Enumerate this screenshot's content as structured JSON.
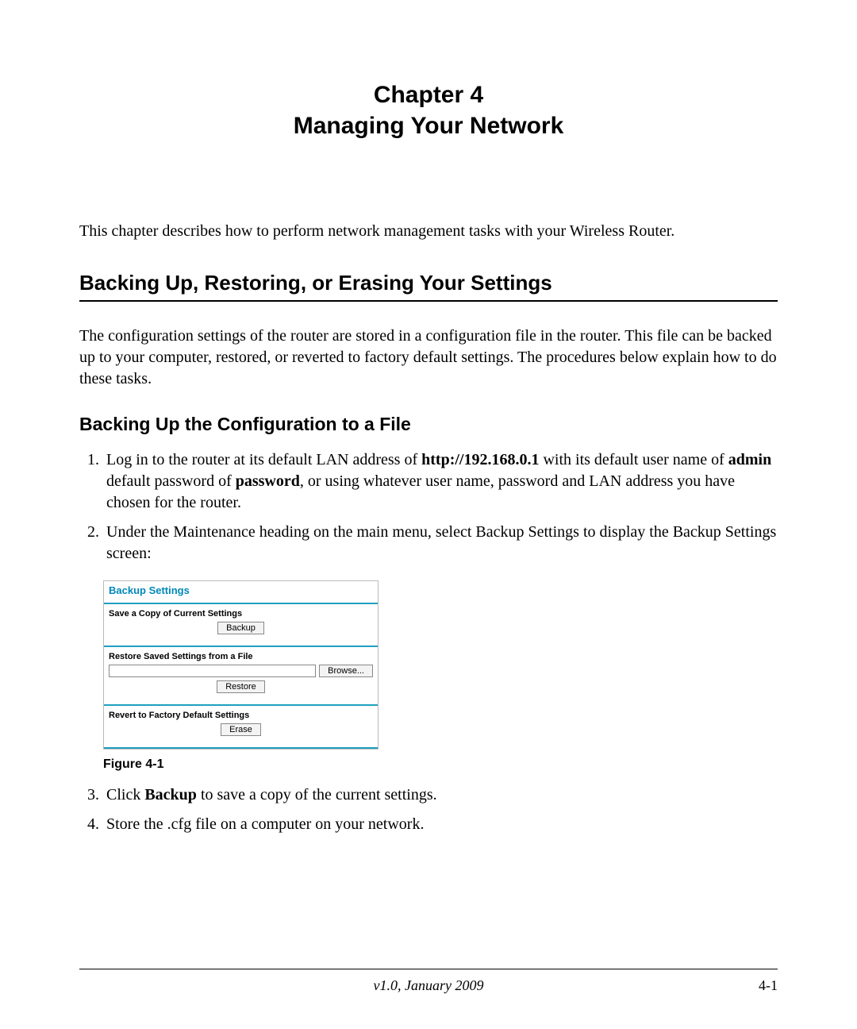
{
  "chapter": {
    "line1": "Chapter 4",
    "line2": "Managing Your Network"
  },
  "intro": "This chapter describes how to perform network management tasks with your Wireless Router.",
  "h1": "Backing Up, Restoring, or Erasing Your Settings",
  "para1": "The configuration settings of the router are stored in a configuration file in the router. This file can be backed up to your computer, restored, or reverted to factory default settings. The procedures below explain how to do these tasks.",
  "h2": "Backing Up the Configuration to a File",
  "steps": {
    "s1_a": "Log in to the router at its default LAN address of ",
    "s1_url": "http://192.168.0.1",
    "s1_b": " with its default user name of ",
    "s1_admin": "admin",
    "s1_c": " default password of ",
    "s1_pw": "password",
    "s1_d": ", or using whatever user name, password and LAN address you have chosen for the router.",
    "s2": "Under the Maintenance heading on the main menu, select Backup Settings to display the Backup Settings screen:",
    "s3_a": "Click ",
    "s3_b": "Backup",
    "s3_c": " to save a copy of the current settings.",
    "s4": "Store the .cfg file on a computer on your network."
  },
  "panel": {
    "title": "Backup Settings",
    "save_label": "Save a Copy of Current Settings",
    "backup_btn": "Backup",
    "restore_label": "Restore Saved Settings from a File",
    "browse_btn": "Browse...",
    "restore_btn": "Restore",
    "revert_label": "Revert to Factory Default Settings",
    "erase_btn": "Erase"
  },
  "figure_caption": "Figure 4-1",
  "footer": {
    "page": "4-1",
    "version": "v1.0, January 2009"
  }
}
